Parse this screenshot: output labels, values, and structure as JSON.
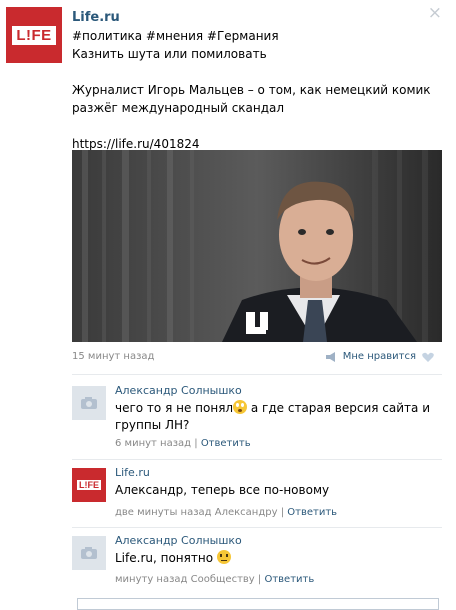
{
  "post": {
    "author": "Life.ru",
    "avatar_text": "L!FE",
    "tags": "#политика #мнения #Германия",
    "title": "Казнить шута или помиловать",
    "body": "Журналист Игорь Мальцев – о том, как немецкий комик разжёг международный скандал",
    "link": "https://life.ru/401824",
    "photo_logo_icon": "life-logo-icon",
    "time": "15 минут назад",
    "like_label": "Мне нравится",
    "close_icon": "×"
  },
  "comments": [
    {
      "author": "Александр Солнышко",
      "text_before": "чего то я не понял",
      "text_after": " а где старая версия сайта и группы ЛН?",
      "emoji": "shocked-emoji",
      "time": "6 минут назад",
      "reply": "Ответить"
    },
    {
      "author": "Life.ru",
      "avatar_text": "L!FE",
      "text": "Александр, теперь все по-новому",
      "time": "две минуты назад Александру",
      "reply": "Ответить"
    },
    {
      "author": "Александр Солнышко",
      "text": "Life.ru, понятно ",
      "emoji": "neutral-emoji",
      "time": "минуту назад Сообществу",
      "reply": "Ответить"
    }
  ],
  "colors": {
    "brand": "#c92a2e",
    "link": "#2b587a",
    "muted": "#888888"
  }
}
